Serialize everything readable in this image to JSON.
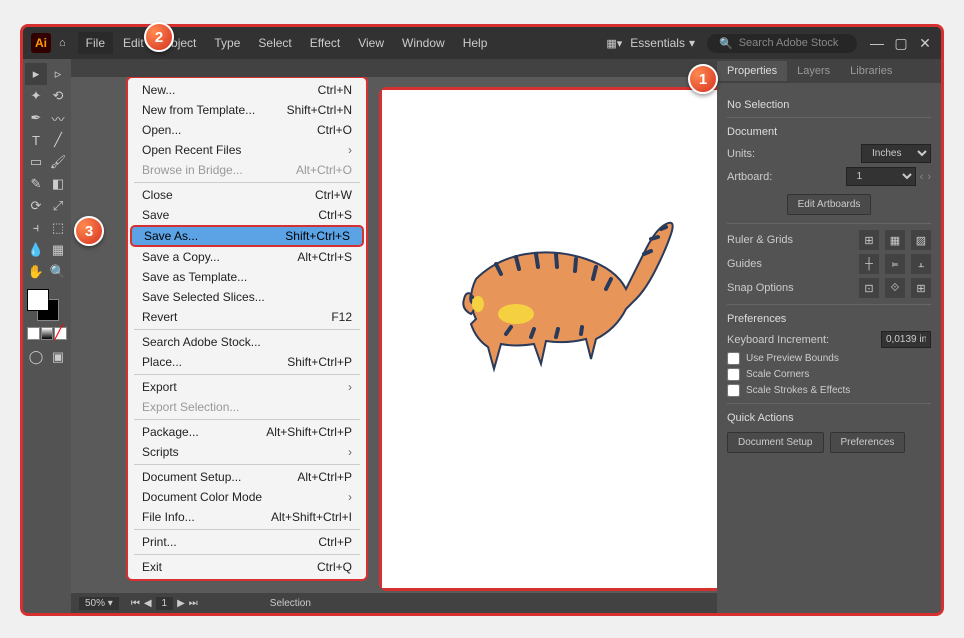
{
  "titlebar": {
    "app_short": "Ai",
    "essentials": "Essentials",
    "search_placeholder": "Search Adobe Stock"
  },
  "menubar": [
    "File",
    "Edit",
    "Object",
    "Type",
    "Select",
    "Effect",
    "View",
    "Window",
    "Help"
  ],
  "file_menu": [
    {
      "label": "New...",
      "shortcut": "Ctrl+N",
      "type": "item"
    },
    {
      "label": "New from Template...",
      "shortcut": "Shift+Ctrl+N",
      "type": "item"
    },
    {
      "label": "Open...",
      "shortcut": "Ctrl+O",
      "type": "item"
    },
    {
      "label": "Open Recent Files",
      "shortcut": "",
      "type": "submenu"
    },
    {
      "label": "Browse in Bridge...",
      "shortcut": "Alt+Ctrl+O",
      "type": "item",
      "disabled": true
    },
    {
      "type": "sep"
    },
    {
      "label": "Close",
      "shortcut": "Ctrl+W",
      "type": "item"
    },
    {
      "label": "Save",
      "shortcut": "Ctrl+S",
      "type": "item"
    },
    {
      "label": "Save As...",
      "shortcut": "Shift+Ctrl+S",
      "type": "item",
      "highlighted": true
    },
    {
      "label": "Save a Copy...",
      "shortcut": "Alt+Ctrl+S",
      "type": "item"
    },
    {
      "label": "Save as Template...",
      "shortcut": "",
      "type": "item"
    },
    {
      "label": "Save Selected Slices...",
      "shortcut": "",
      "type": "item"
    },
    {
      "label": "Revert",
      "shortcut": "F12",
      "type": "item"
    },
    {
      "type": "sep"
    },
    {
      "label": "Search Adobe Stock...",
      "shortcut": "",
      "type": "item"
    },
    {
      "label": "Place...",
      "shortcut": "Shift+Ctrl+P",
      "type": "item"
    },
    {
      "type": "sep"
    },
    {
      "label": "Export",
      "shortcut": "",
      "type": "submenu"
    },
    {
      "label": "Export Selection...",
      "shortcut": "",
      "type": "item",
      "disabled": true
    },
    {
      "type": "sep"
    },
    {
      "label": "Package...",
      "shortcut": "Alt+Shift+Ctrl+P",
      "type": "item"
    },
    {
      "label": "Scripts",
      "shortcut": "",
      "type": "submenu"
    },
    {
      "type": "sep"
    },
    {
      "label": "Document Setup...",
      "shortcut": "Alt+Ctrl+P",
      "type": "item"
    },
    {
      "label": "Document Color Mode",
      "shortcut": "",
      "type": "submenu"
    },
    {
      "label": "File Info...",
      "shortcut": "Alt+Shift+Ctrl+I",
      "type": "item"
    },
    {
      "type": "sep"
    },
    {
      "label": "Print...",
      "shortcut": "Ctrl+P",
      "type": "item"
    },
    {
      "type": "sep"
    },
    {
      "label": "Exit",
      "shortcut": "Ctrl+Q",
      "type": "item"
    }
  ],
  "status": {
    "zoom": "50%",
    "page": "1",
    "mode": "Selection"
  },
  "properties": {
    "tabs": [
      "Properties",
      "Layers",
      "Libraries"
    ],
    "no_selection": "No Selection",
    "document": "Document",
    "units_label": "Units:",
    "units_value": "Inches",
    "artboard_label": "Artboard:",
    "artboard_value": "1",
    "edit_artboards": "Edit Artboards",
    "ruler_grids": "Ruler & Grids",
    "guides": "Guides",
    "snap_options": "Snap Options",
    "preferences": "Preferences",
    "keyboard_inc_label": "Keyboard Increment:",
    "keyboard_inc_value": "0,0139 in",
    "cb_preview": "Use Preview Bounds",
    "cb_corners": "Scale Corners",
    "cb_strokes": "Scale Strokes & Effects",
    "quick_actions": "Quick Actions",
    "doc_setup_btn": "Document Setup",
    "prefs_btn": "Preferences"
  },
  "callouts": {
    "c1": "1",
    "c2": "2",
    "c3": "3"
  }
}
